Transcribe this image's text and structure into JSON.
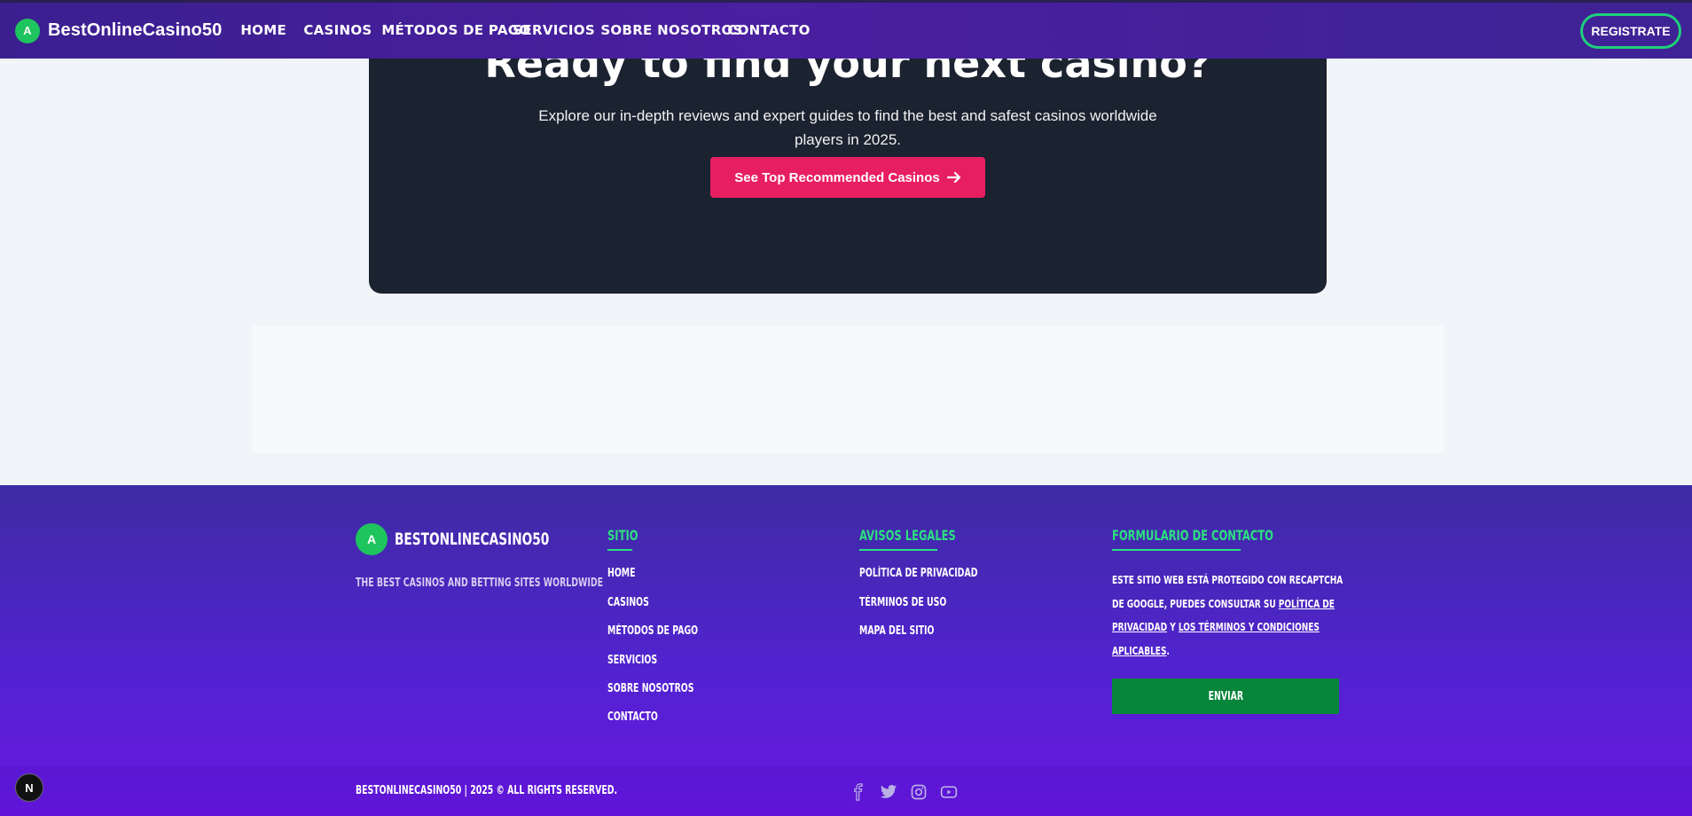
{
  "header": {
    "logo_letter": "A",
    "logo_text": "BestOnlineCasino50",
    "nav": [
      "HOME",
      "CASINOS",
      "MÉTODOS DE PAGO",
      "SERVICIOS",
      "SOBRE NOSOTROS",
      "CONTACTO"
    ],
    "register_label": "REGISTRATE"
  },
  "hero": {
    "title": "Ready to find your next casino?",
    "subtitle": "Explore our in-depth reviews and expert guides to find the best and safest casinos worldwide players in 2025.",
    "button_label": "See Top Recommended Casinos",
    "button_color": "#e81e63"
  },
  "footer": {
    "logo_letter": "A",
    "logo_text": "BESTONLINECASINO50",
    "tagline": "THE BEST CASINOS AND BETTING SITES WORLDWIDE",
    "sitio": {
      "title": "SITIO",
      "links": [
        "HOME",
        "CASINOS",
        "MÉTODOS DE PAGO",
        "SERVICIOS",
        "SOBRE NOSOTROS",
        "CONTACTO"
      ]
    },
    "legal": {
      "title": "AVISOS LEGALES",
      "links": [
        "POLÍTICA DE PRIVACIDAD",
        "TÉRMINOS DE USO",
        "MAPA DEL SITIO"
      ]
    },
    "contact": {
      "title": "FORMULARIO DE CONTACTO",
      "text_1": "ESTE SITIO WEB ESTÁ PROTEGIDO CON RECAPTCHA DE GOOGLE, PUEDES CONSULTAR SU ",
      "privacy_link": "POLÍTICA DE PRIVACIDAD",
      "text_2": " Y ",
      "terms_link": "LOS TÉRMINOS Y CONDICIONES APLICABLES",
      "text_3": ".",
      "send_label": "ENVIAR"
    },
    "copyright": "BESTONLINECASINO50 | 2025 © ALL RIGHTS RESERVED.",
    "social_icons": [
      "facebook-icon",
      "twitter-icon",
      "instagram-icon",
      "youtube-icon"
    ]
  },
  "dev_badge": "N",
  "colors": {
    "accent_green": "#2be07f",
    "header_purple": "#4a1fa0",
    "hero_bg": "#1b2230"
  }
}
